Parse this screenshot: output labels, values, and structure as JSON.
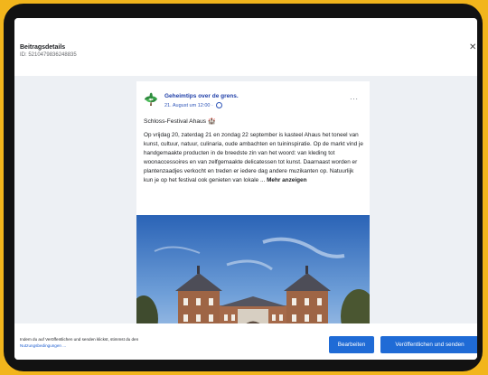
{
  "dialog": {
    "title": "Beitragsdetails",
    "id_label": "ID: 5210479836248835",
    "close_icon": "close-icon"
  },
  "post": {
    "page_name": "Geheimtips over de grens.",
    "meta": "21. August um 12:00 ·  ",
    "heading": "Schloss-Festival Ahaus 🏰",
    "body": "Op vrijdag 20, zaterdag 21 en zondag 22 september is kasteel Ahaus het toneel van kunst, cultuur, natuur, culinaria, oude ambachten en tuininspiratie. Op de markt vind je handgemaakte producten in de breedste zin van het woord: van kleding tot woonaccessoires en van zelfgemaakte delicatessen tot kunst. Daarnaast worden er plantenzaadjes verkocht en treden er iedere dag andere muzikanten op. Natuurlijk kun je op het festival ook genieten van lokale ...",
    "more_link": "Mehr anzeigen",
    "more_options": "···",
    "avatar_icon": "palm-tree-icon",
    "image_alt": "Schloss Ahaus"
  },
  "footer": {
    "consent_text": "Indem du auf Veröffentlichen und senden klickst, stimmst du den",
    "terms_link": "Nutzungsbedingungen ...",
    "edit_label": "Bearbeiten",
    "publish_label": "Veröffentlichen und senden"
  },
  "colors": {
    "frame": "#f2b51c",
    "bezel": "#121212",
    "accent": "#1f6bd6",
    "link": "#1f3fa8"
  }
}
